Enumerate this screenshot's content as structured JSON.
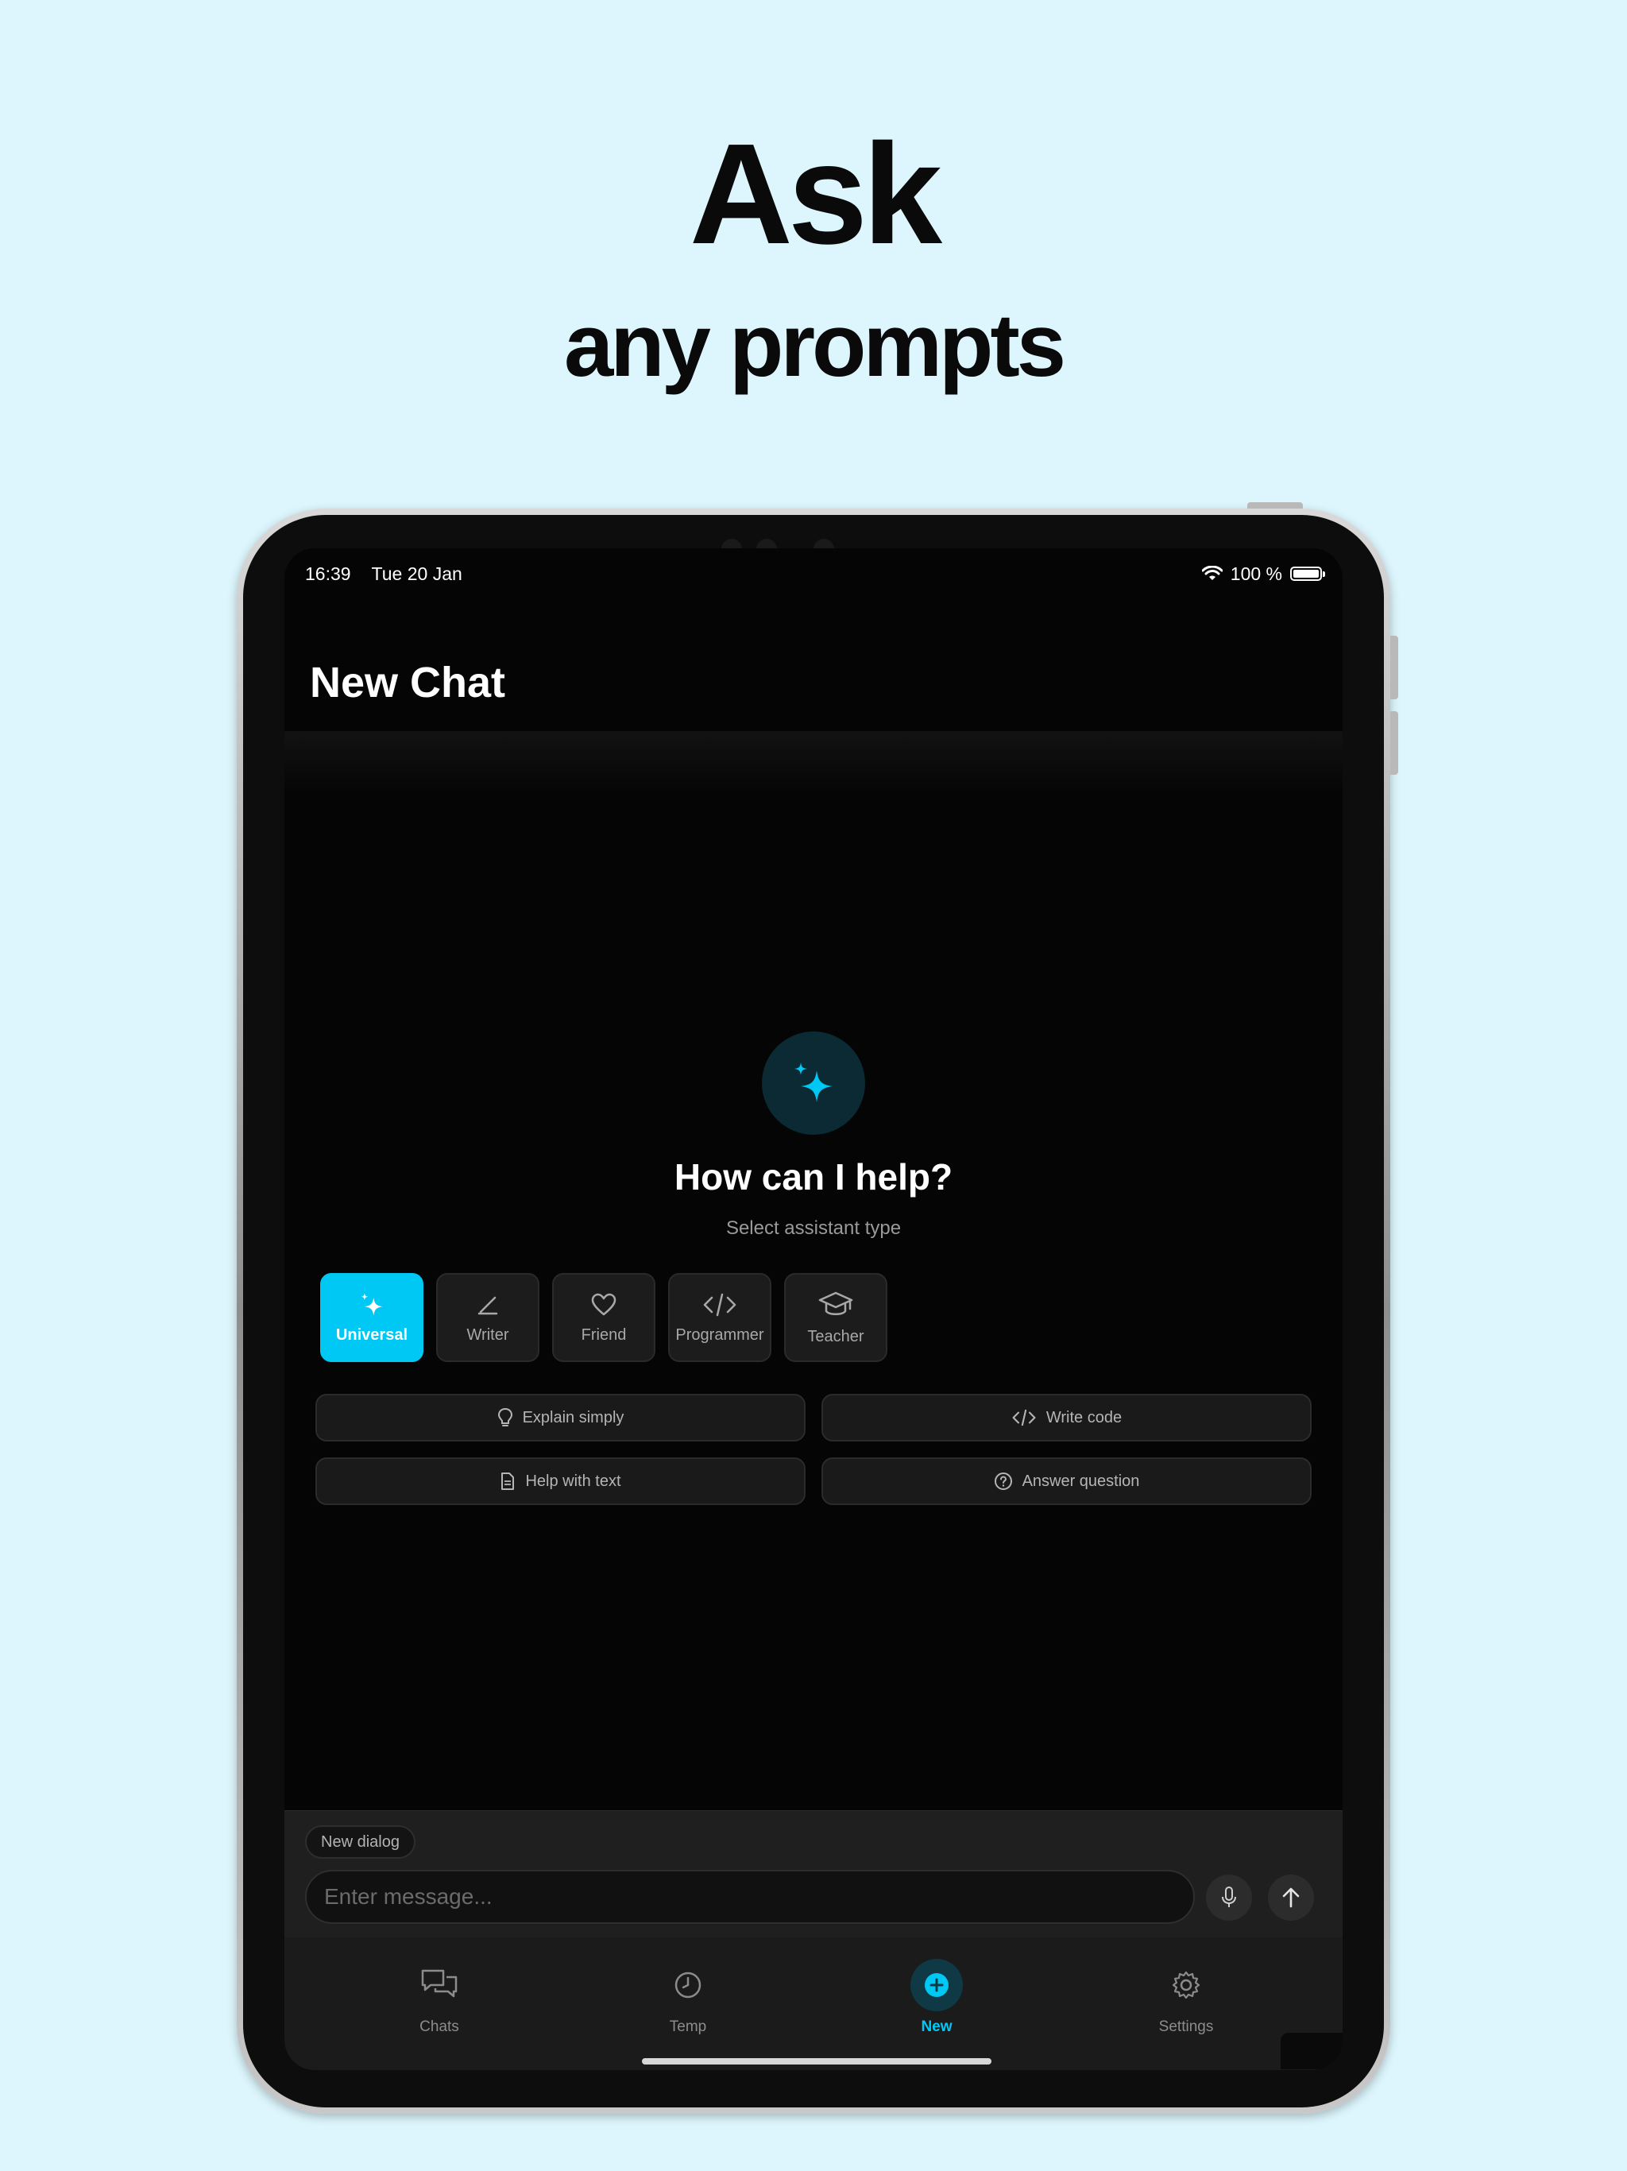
{
  "headline": {
    "line1": "Ask",
    "line2": "any prompts"
  },
  "status_bar": {
    "time": "16:39",
    "date": "Tue 20 Jan",
    "battery": "100 %"
  },
  "page": {
    "title": "New Chat"
  },
  "empty_state": {
    "title": "How can I help?",
    "subtitle": "Select assistant type"
  },
  "assistant_types": [
    {
      "label": "Universal",
      "icon": "sparkles-icon",
      "selected": true
    },
    {
      "label": "Writer",
      "icon": "pen-icon",
      "selected": false
    },
    {
      "label": "Friend",
      "icon": "heart-icon",
      "selected": false
    },
    {
      "label": "Programmer",
      "icon": "code-icon",
      "selected": false
    },
    {
      "label": "Teacher",
      "icon": "graduation-cap-icon",
      "selected": false
    }
  ],
  "prompts": [
    {
      "label": "Explain simply",
      "icon": "lightbulb-icon"
    },
    {
      "label": "Write code",
      "icon": "code-icon"
    },
    {
      "label": "Help with text",
      "icon": "document-icon"
    },
    {
      "label": "Answer question",
      "icon": "question-circle-icon"
    }
  ],
  "composer": {
    "chip": "New dialog",
    "placeholder": "Enter message..."
  },
  "tabs": [
    {
      "label": "Chats",
      "icon": "chat-bubbles-icon",
      "active": false
    },
    {
      "label": "Temp",
      "icon": "clock-icon",
      "active": false
    },
    {
      "label": "New",
      "icon": "plus-circle-icon",
      "active": true
    },
    {
      "label": "Settings",
      "icon": "gear-icon",
      "active": false
    }
  ],
  "colors": {
    "accent": "#00c8f5",
    "background": "#ddf6fd",
    "screen": "#050505"
  }
}
